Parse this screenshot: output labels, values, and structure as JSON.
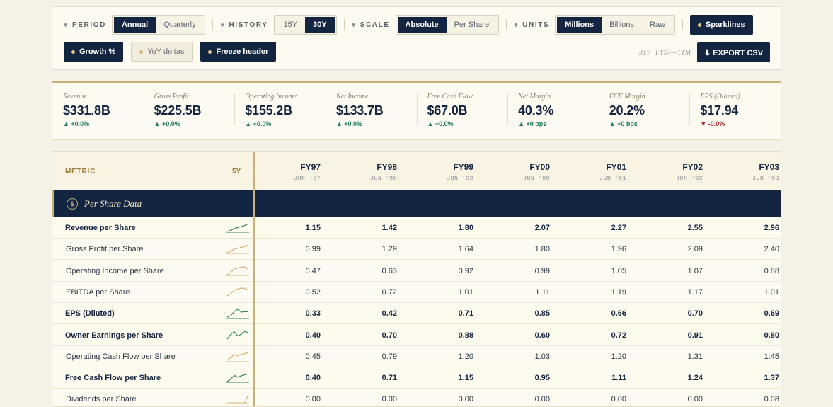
{
  "toolbar": {
    "period": {
      "label": "PERIOD",
      "options": [
        "Annual",
        "Quarterly"
      ],
      "selected": "Annual"
    },
    "history": {
      "label": "HISTORY",
      "options": [
        "15Y",
        "30Y"
      ],
      "selected": "30Y"
    },
    "scale": {
      "label": "SCALE",
      "options": [
        "Absolute",
        "Per Share"
      ],
      "selected": "Absolute"
    },
    "units": {
      "label": "UNITS",
      "options": [
        "Millions",
        "Billions",
        "Raw"
      ],
      "selected": "Millions"
    },
    "sparklines": "Sparklines",
    "growth": "Growth %",
    "yoy": "YoY deltas",
    "freeze": "Freeze header",
    "range_note": "31Y · FY97—TTM",
    "export": "⬇ EXPORT CSV"
  },
  "kpis": [
    {
      "label": "Revenue",
      "value": "$331.8B",
      "delta": "▲ +0.0%",
      "dir": "up"
    },
    {
      "label": "Gross Profit",
      "value": "$225.5B",
      "delta": "▲ +0.0%",
      "dir": "up"
    },
    {
      "label": "Operating Income",
      "value": "$155.2B",
      "delta": "▲ +0.0%",
      "dir": "up"
    },
    {
      "label": "Net Income",
      "value": "$133.7B",
      "delta": "▲ +0.0%",
      "dir": "up"
    },
    {
      "label": "Free Cash Flow",
      "value": "$67.0B",
      "delta": "▲ +0.0%",
      "dir": "up"
    },
    {
      "label": "Net Margin",
      "value": "40.3%",
      "delta": "▲ +0 bps",
      "dir": "up"
    },
    {
      "label": "FCF Margin",
      "value": "20.2%",
      "delta": "▲ +0 bps",
      "dir": "up"
    },
    {
      "label": "EPS (Diluted)",
      "value": "$17.94",
      "delta": "▼ -0.0%",
      "dir": "down"
    }
  ],
  "table": {
    "metric_header": "METRIC",
    "spark_header": "5Y",
    "columns": [
      {
        "fy": "FY97",
        "date": "JUN '97"
      },
      {
        "fy": "FY98",
        "date": "JUN '98"
      },
      {
        "fy": "FY99",
        "date": "JUN '99"
      },
      {
        "fy": "FY00",
        "date": "JUN '00"
      },
      {
        "fy": "FY01",
        "date": "JUN '01"
      },
      {
        "fy": "FY02",
        "date": "JUN '02"
      },
      {
        "fy": "FY03",
        "date": "JUN '03"
      }
    ],
    "section": {
      "icon": "$",
      "title": "Per Share Data"
    },
    "rows": [
      {
        "label": "Revenue per Share",
        "bold": true,
        "spark_color": "#1d7a52",
        "values": [
          "1.15",
          "1.42",
          "1.80",
          "2.07",
          "2.27",
          "2.55",
          "2.96"
        ]
      },
      {
        "label": "Gross Profit per Share",
        "bold": false,
        "spark_color": "#d2ae72",
        "values": [
          "0.99",
          "1.29",
          "1.64",
          "1.80",
          "1.96",
          "2.09",
          "2.40"
        ]
      },
      {
        "label": "Operating Income per Share",
        "bold": false,
        "spark_color": "#d2ae72",
        "values": [
          "0.47",
          "0.63",
          "0.92",
          "0.99",
          "1.05",
          "1.07",
          "0.88"
        ]
      },
      {
        "label": "EBITDA per Share",
        "bold": false,
        "spark_color": "#d2ae72",
        "values": [
          "0.52",
          "0.72",
          "1.01",
          "1.11",
          "1.19",
          "1.17",
          "1.01"
        ]
      },
      {
        "label": "EPS (Diluted)",
        "bold": true,
        "spark_color": "#1d7a52",
        "values": [
          "0.33",
          "0.42",
          "0.71",
          "0.85",
          "0.66",
          "0.70",
          "0.69"
        ]
      },
      {
        "label": "Owner Earnings per Share",
        "bold": true,
        "spark_color": "#1d7a52",
        "values": [
          "0.40",
          "0.70",
          "0.88",
          "0.60",
          "0.72",
          "0.91",
          "0.80"
        ]
      },
      {
        "label": "Operating Cash Flow per Share",
        "bold": false,
        "spark_color": "#d2ae72",
        "values": [
          "0.45",
          "0.79",
          "1.20",
          "1.03",
          "1.20",
          "1.31",
          "1.45"
        ]
      },
      {
        "label": "Free Cash Flow per Share",
        "bold": true,
        "spark_color": "#1d7a52",
        "values": [
          "0.40",
          "0.71",
          "1.15",
          "0.95",
          "1.11",
          "1.24",
          "1.37"
        ]
      },
      {
        "label": "Dividends per Share",
        "bold": false,
        "spark_color": "#d2ae72",
        "values": [
          "0.00",
          "0.00",
          "0.00",
          "0.00",
          "0.00",
          "0.00",
          "0.08"
        ]
      }
    ]
  }
}
